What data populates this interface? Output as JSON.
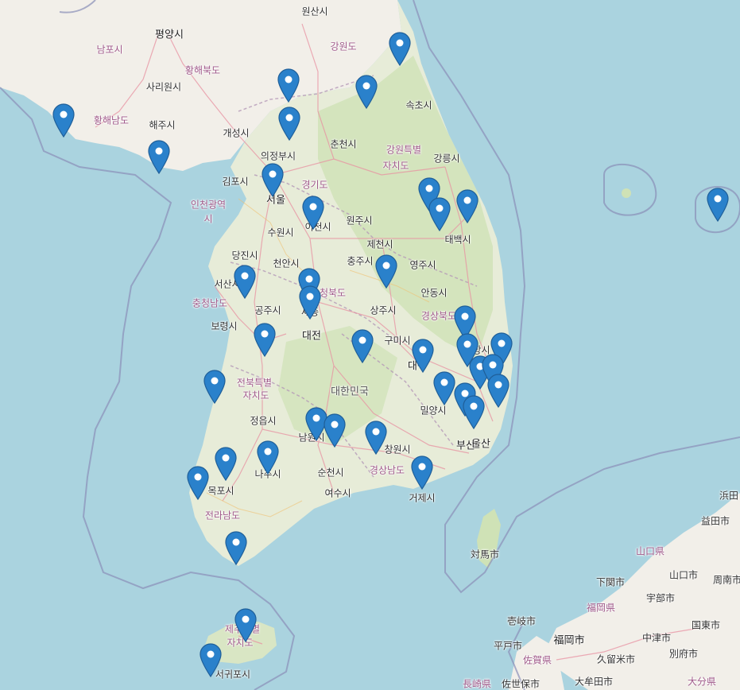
{
  "map": {
    "labels": [
      {
        "name": "원산시",
        "type": "city"
      },
      {
        "name": "평양시",
        "type": "major"
      },
      {
        "name": "남포시",
        "type": "region"
      },
      {
        "name": "황해북도",
        "type": "region"
      },
      {
        "name": "사리원시",
        "type": "city"
      },
      {
        "name": "강원도",
        "type": "region"
      },
      {
        "name": "황해남도",
        "type": "region"
      },
      {
        "name": "해주시",
        "type": "city"
      },
      {
        "name": "개성시",
        "type": "city"
      },
      {
        "name": "속초시",
        "type": "city"
      },
      {
        "name": "춘천시",
        "type": "city"
      },
      {
        "name": "의정부시",
        "type": "city"
      },
      {
        "name": "강원특별",
        "type": "region"
      },
      {
        "name": "자치도",
        "type": "region"
      },
      {
        "name": "강릉시",
        "type": "city"
      },
      {
        "name": "김포시",
        "type": "city"
      },
      {
        "name": "경기도",
        "type": "region"
      },
      {
        "name": "인천광역",
        "type": "region"
      },
      {
        "name": "시",
        "type": "region"
      },
      {
        "name": "서울",
        "type": "major"
      },
      {
        "name": "원주시",
        "type": "city"
      },
      {
        "name": "태백시",
        "type": "city"
      },
      {
        "name": "수원시",
        "type": "city"
      },
      {
        "name": "이천시",
        "type": "city"
      },
      {
        "name": "제천시",
        "type": "city"
      },
      {
        "name": "당진시",
        "type": "city"
      },
      {
        "name": "천안시",
        "type": "city"
      },
      {
        "name": "충주시",
        "type": "city"
      },
      {
        "name": "영주시",
        "type": "city"
      },
      {
        "name": "서산시",
        "type": "city"
      },
      {
        "name": "충청북도",
        "type": "region"
      },
      {
        "name": "충청남도",
        "type": "region"
      },
      {
        "name": "안동시",
        "type": "city"
      },
      {
        "name": "공주시",
        "type": "city"
      },
      {
        "name": "세종",
        "type": "city"
      },
      {
        "name": "상주시",
        "type": "city"
      },
      {
        "name": "경상북도",
        "type": "region"
      },
      {
        "name": "보령시",
        "type": "city"
      },
      {
        "name": "대전",
        "type": "major"
      },
      {
        "name": "구미시",
        "type": "city"
      },
      {
        "name": "포항시",
        "type": "city"
      },
      {
        "name": "대구",
        "type": "major"
      },
      {
        "name": "전북특별",
        "type": "region"
      },
      {
        "name": "자치도",
        "type": "region"
      },
      {
        "name": "대한민국",
        "type": "country"
      },
      {
        "name": "밀양시",
        "type": "city"
      },
      {
        "name": "정읍시",
        "type": "city"
      },
      {
        "name": "울산",
        "type": "major"
      },
      {
        "name": "남원시",
        "type": "city"
      },
      {
        "name": "창원시",
        "type": "city"
      },
      {
        "name": "부산",
        "type": "major"
      },
      {
        "name": "나주시",
        "type": "city"
      },
      {
        "name": "순천시",
        "type": "city"
      },
      {
        "name": "경상남도",
        "type": "region"
      },
      {
        "name": "목포시",
        "type": "city"
      },
      {
        "name": "여수시",
        "type": "city"
      },
      {
        "name": "거제시",
        "type": "city"
      },
      {
        "name": "전라남도",
        "type": "region"
      },
      {
        "name": "対馬市",
        "type": "city"
      },
      {
        "name": "浜田",
        "type": "city"
      },
      {
        "name": "益田市",
        "type": "city"
      },
      {
        "name": "山口県",
        "type": "region"
      },
      {
        "name": "下関市",
        "type": "city"
      },
      {
        "name": "山口市",
        "type": "city"
      },
      {
        "name": "周南市",
        "type": "city"
      },
      {
        "name": "宇部市",
        "type": "city"
      },
      {
        "name": "壱岐市",
        "type": "city"
      },
      {
        "name": "福岡県",
        "type": "region"
      },
      {
        "name": "国東市",
        "type": "city"
      },
      {
        "name": "제주특별",
        "type": "region"
      },
      {
        "name": "자치도",
        "type": "region"
      },
      {
        "name": "平戸市",
        "type": "city"
      },
      {
        "name": "福岡市",
        "type": "major"
      },
      {
        "name": "中津市",
        "type": "city"
      },
      {
        "name": "佐賀県",
        "type": "region"
      },
      {
        "name": "久留米市",
        "type": "city"
      },
      {
        "name": "別府市",
        "type": "city"
      },
      {
        "name": "서귀포시",
        "type": "city"
      },
      {
        "name": "長崎県",
        "type": "region"
      },
      {
        "name": "佐世保市",
        "type": "city"
      },
      {
        "name": "大牟田市",
        "type": "city"
      },
      {
        "name": "大分県",
        "type": "region"
      }
    ],
    "marker_color": "#2a81cb",
    "marker_count": 44
  }
}
